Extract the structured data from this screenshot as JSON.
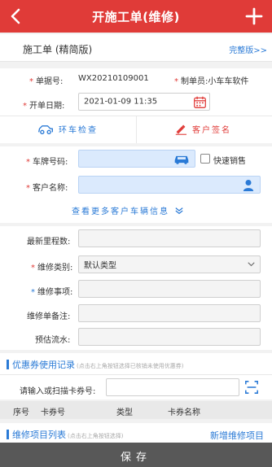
{
  "header": {
    "title": "开施工单(维修)",
    "back_icon": "chevron-left-icon",
    "add_icon": "plus-icon",
    "background": "#e03b38"
  },
  "mode": {
    "title": "施工单 (精简版)",
    "full_link": "完整版>>"
  },
  "order": {
    "doc_no_label": "单据号:",
    "doc_no_value": "WX20210109001",
    "maker_label": "制单员:",
    "maker_value": "小车车软件",
    "date_label": "开单日期:",
    "date_value": "2021-01-09 11:35",
    "inspect_label": "环车检查",
    "sign_label": "客户签名"
  },
  "customer": {
    "plate_label": "车牌号码:",
    "plate_value": "",
    "quick_sale_label": "快速销售",
    "name_label": "客户名称:",
    "name_value": "",
    "more_info_label": "查看更多客户车辆信息"
  },
  "repair": {
    "mileage_label": "最新里程数:",
    "mileage_value": "",
    "type_label": "维修类别:",
    "type_value": "默认类型",
    "item_label": "维修事项:",
    "item_value": "",
    "remark_label": "维修单备注:",
    "remark_value": "",
    "flow_label": "预估流水:",
    "flow_value": ""
  },
  "coupon": {
    "section_title": "优惠券使用记录",
    "section_hint": "(点击右上角按钮选择已核销未使用优惠券)",
    "input_label": "请输入或扫描卡券号:",
    "input_value": "",
    "columns": [
      "序号",
      "卡券号",
      "类型",
      "卡券名称"
    ]
  },
  "items": {
    "section_title": "维修项目列表",
    "section_hint": "(点击右上角按钮选择)",
    "add_label": "新增维修项目"
  },
  "footer": {
    "save_label": "保存"
  },
  "colors": {
    "accent_red": "#e03b38",
    "link_blue": "#2a7ad6",
    "highlight_field": "#dbeafd"
  }
}
